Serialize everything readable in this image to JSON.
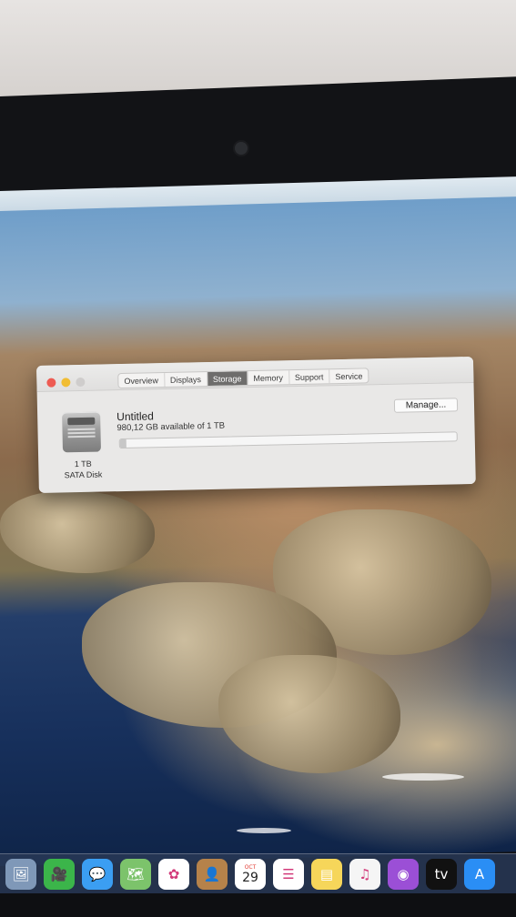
{
  "window": {
    "tabs": [
      {
        "label": "Overview"
      },
      {
        "label": "Displays"
      },
      {
        "label": "Storage",
        "active": true
      },
      {
        "label": "Memory"
      },
      {
        "label": "Support"
      },
      {
        "label": "Service"
      }
    ],
    "storage": {
      "volume_name": "Untitled",
      "available_text": "980,12 GB available of 1 TB",
      "disk_size": "1 TB",
      "disk_type": "SATA Disk",
      "used_fraction": 0.02,
      "manage_label": "Manage..."
    }
  },
  "dock": {
    "items": [
      {
        "name": "preview-icon",
        "glyph": "🖼",
        "bg": "#7f98b8"
      },
      {
        "name": "facetime-icon",
        "glyph": "🎥",
        "bg": "#3bb54a"
      },
      {
        "name": "messages-icon",
        "glyph": "💬",
        "bg": "#3b9ef2"
      },
      {
        "name": "maps-icon",
        "glyph": "🗺",
        "bg": "#7cc36b"
      },
      {
        "name": "photos-icon",
        "glyph": "✿",
        "bg": "#ffffff"
      },
      {
        "name": "contacts-icon",
        "glyph": "👤",
        "bg": "#b5824a"
      },
      {
        "name": "calendar-icon",
        "glyph": "",
        "bg": "#ffffff"
      },
      {
        "name": "reminders-icon",
        "glyph": "☰",
        "bg": "#ffffff"
      },
      {
        "name": "notes-icon",
        "glyph": "▤",
        "bg": "#f6d65a"
      },
      {
        "name": "music-icon",
        "glyph": "♫",
        "bg": "#f5f5f5"
      },
      {
        "name": "podcasts-icon",
        "glyph": "◉",
        "bg": "#9b4fd6"
      },
      {
        "name": "tv-icon",
        "glyph": "tv",
        "bg": "#111111"
      },
      {
        "name": "app-store-icon",
        "glyph": "A",
        "bg": "#2a8ef5"
      }
    ],
    "calendar": {
      "month": "OCT",
      "day": "29"
    }
  }
}
